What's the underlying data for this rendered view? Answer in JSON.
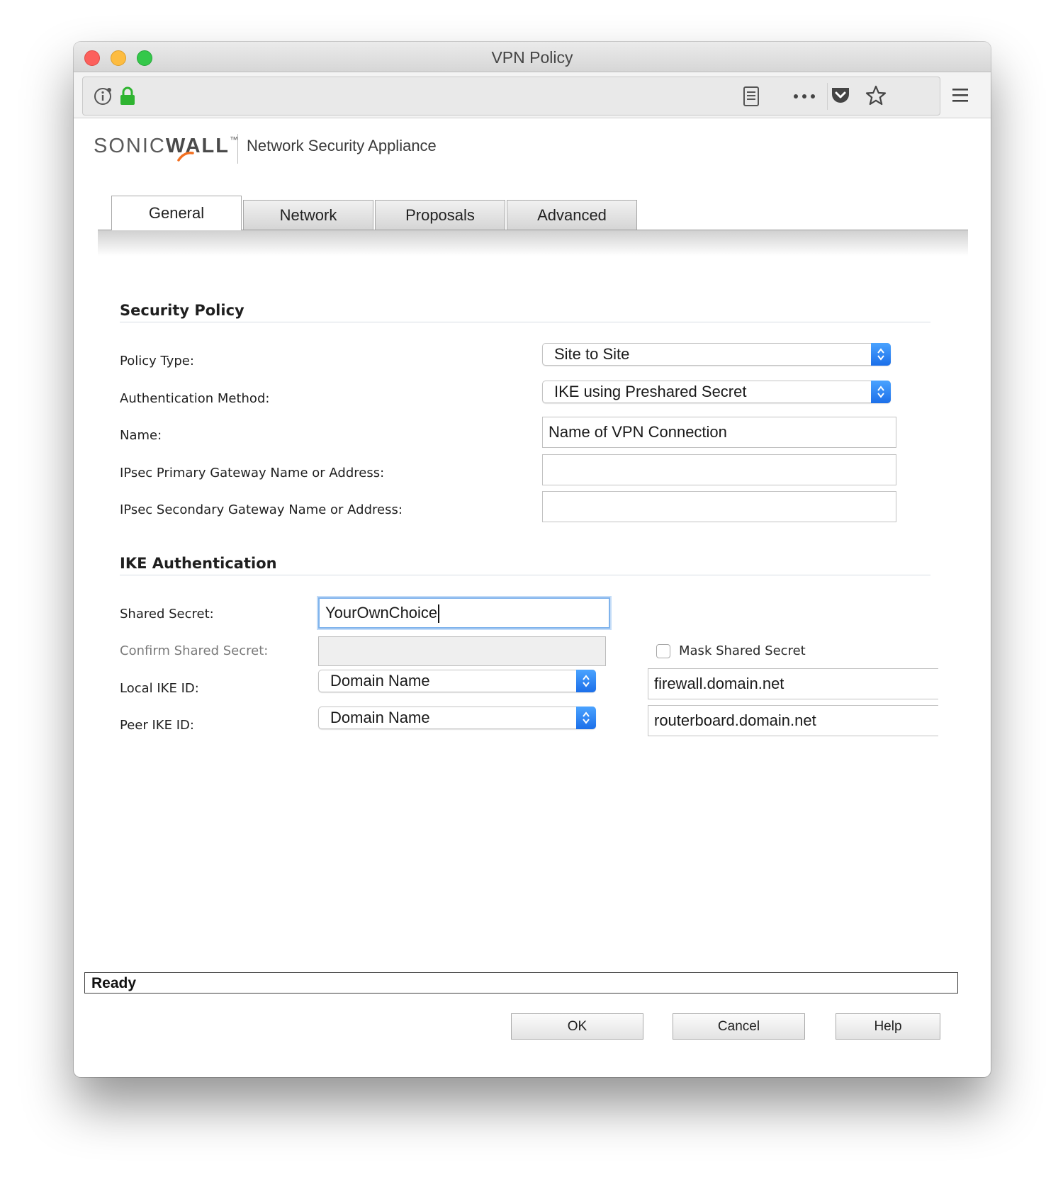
{
  "window": {
    "title": "VPN Policy"
  },
  "browser": {
    "icons": [
      "info-icon",
      "lock-icon",
      "reader-view-icon",
      "more-icon",
      "pocket-icon",
      "bookmark-star-icon",
      "menu-icon"
    ]
  },
  "header": {
    "logo_text_a": "SONIC",
    "logo_text_b": "WALL",
    "logo_tm": "™",
    "product": "Network Security Appliance"
  },
  "tabs": [
    {
      "label": "General",
      "active": true
    },
    {
      "label": "Network",
      "active": false
    },
    {
      "label": "Proposals",
      "active": false
    },
    {
      "label": "Advanced",
      "active": false
    }
  ],
  "security_policy": {
    "title": "Security Policy",
    "policy_type": {
      "label": "Policy Type:",
      "value": "Site to Site"
    },
    "auth_method": {
      "label": "Authentication Method:",
      "value": "IKE using Preshared Secret"
    },
    "name": {
      "label": "Name:",
      "value": "Name of VPN Connection"
    },
    "primary_gw": {
      "label": "IPsec Primary Gateway Name or Address:",
      "value": ""
    },
    "secondary_gw": {
      "label": "IPsec Secondary Gateway Name or Address:",
      "value": ""
    }
  },
  "ike_auth": {
    "title": "IKE Authentication",
    "shared_secret": {
      "label": "Shared Secret:",
      "value": "YourOwnChoice"
    },
    "confirm_secret": {
      "label": "Confirm Shared Secret:",
      "value": ""
    },
    "mask_secret": {
      "label": "Mask Shared Secret",
      "checked": false
    },
    "local_ike_id": {
      "label": "Local IKE ID:",
      "type": "Domain Name",
      "value": "firewall.domain.net"
    },
    "peer_ike_id": {
      "label": "Peer IKE ID:",
      "type": "Domain Name",
      "value": "routerboard.domain.net"
    }
  },
  "status": "Ready",
  "buttons": {
    "ok": "OK",
    "cancel": "Cancel",
    "help": "Help"
  },
  "colors": {
    "accent_blue": "#1c6fe9",
    "lock_green": "#2fb431",
    "logo_orange": "#f37021"
  }
}
